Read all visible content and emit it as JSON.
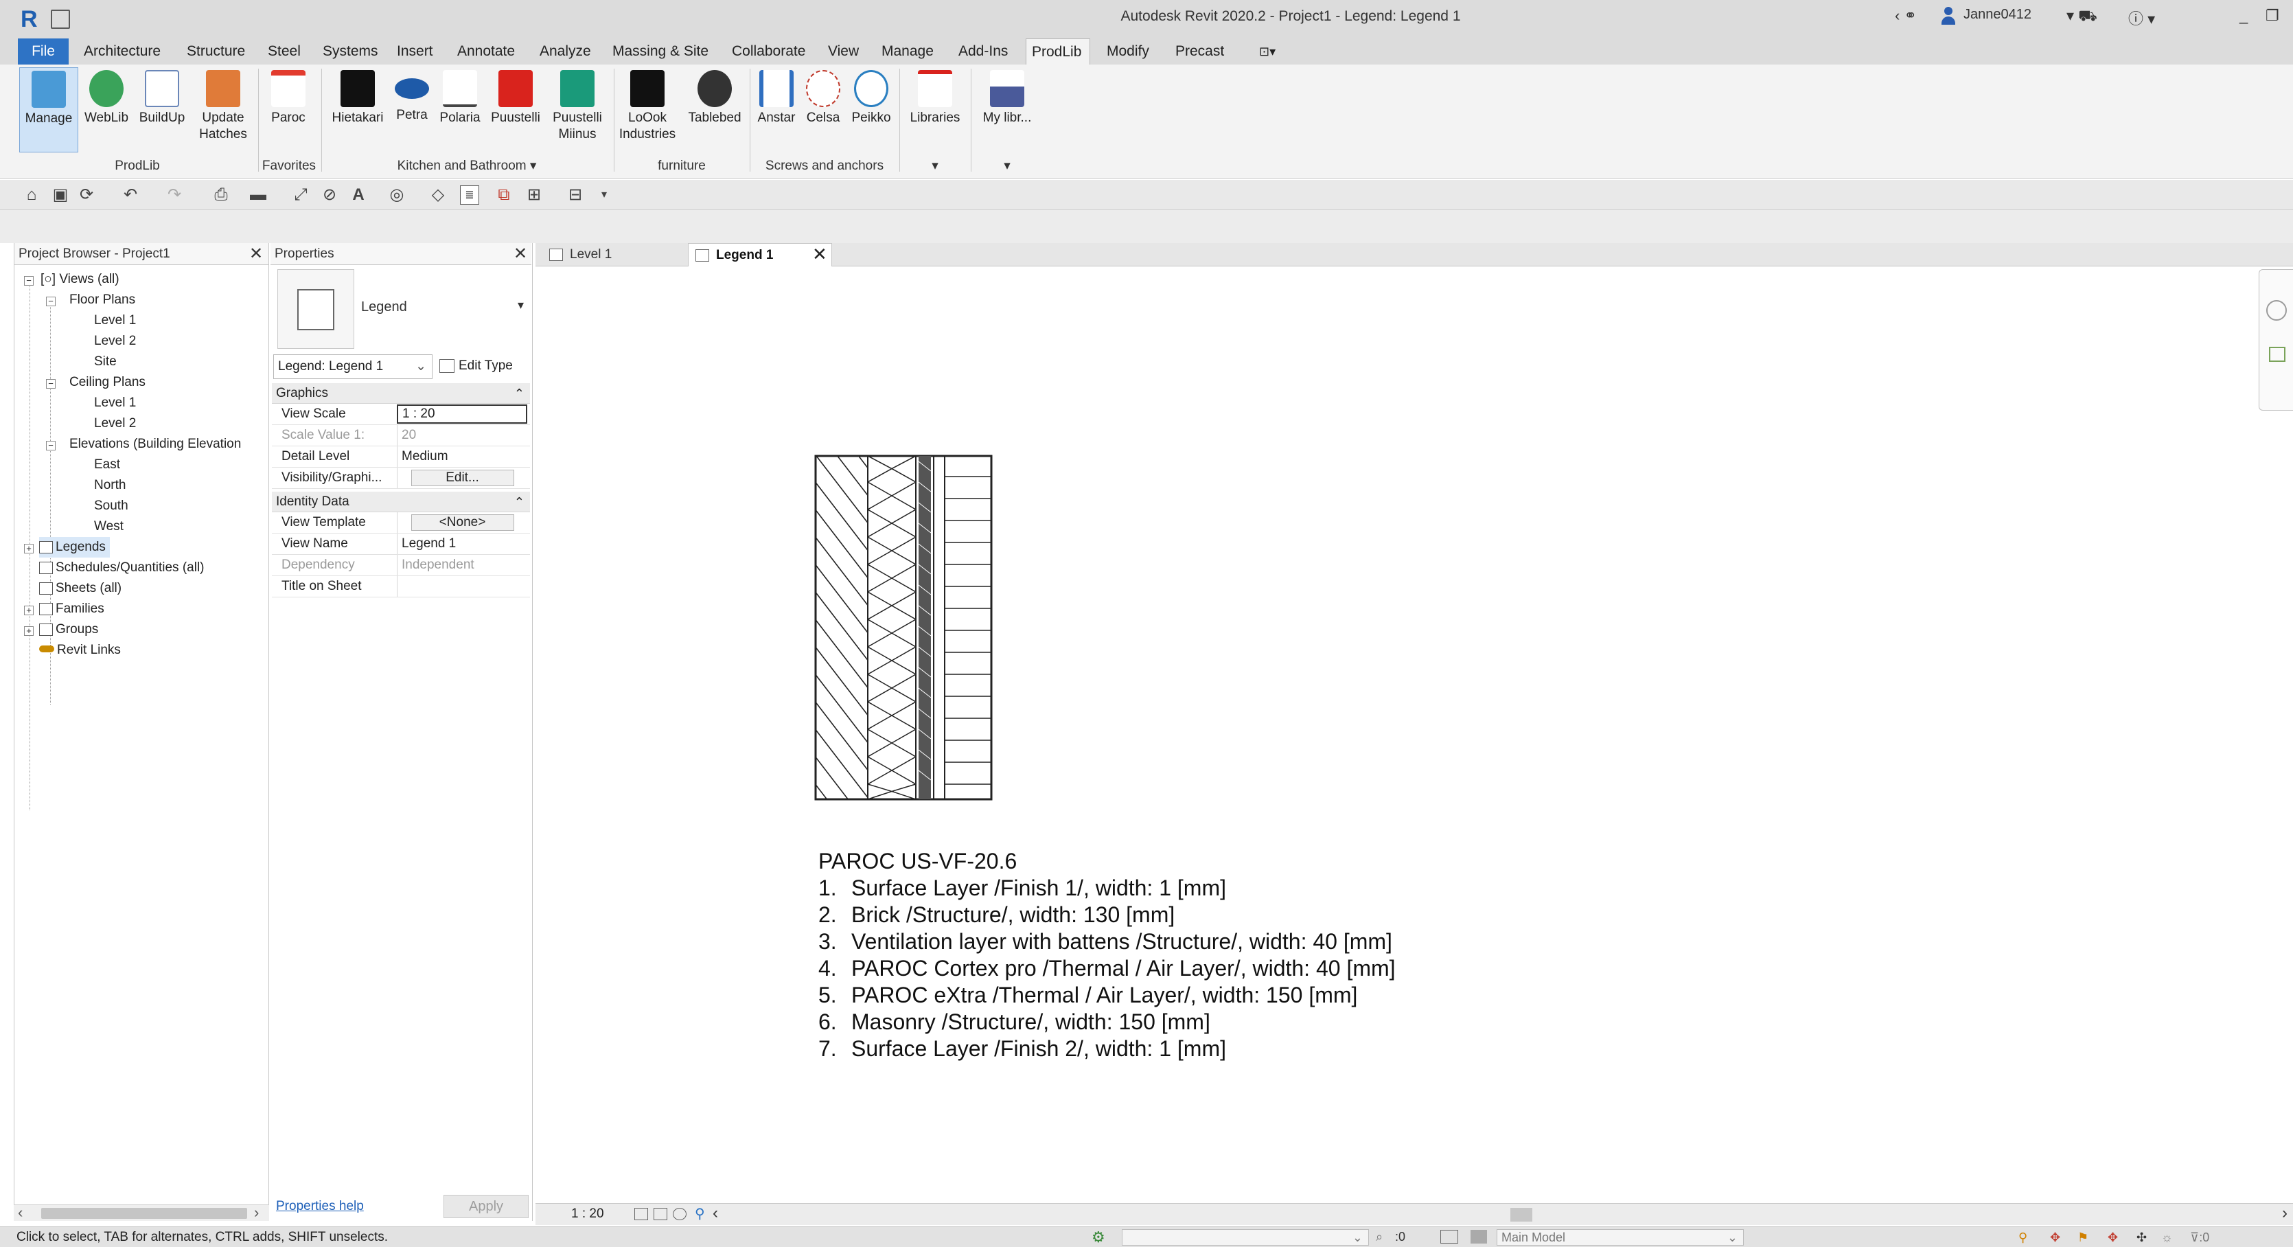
{
  "app": {
    "logo": "R",
    "title": "Autodesk Revit 2020.2 - Project1 - Legend: Legend 1",
    "user": "Janne0412"
  },
  "ribbon_tabs": [
    "File",
    "Architecture",
    "Structure",
    "Steel",
    "Systems",
    "Insert",
    "Annotate",
    "Analyze",
    "Massing & Site",
    "Collaborate",
    "View",
    "Manage",
    "Add-Ins",
    "ProdLib",
    "Modify",
    "Precast"
  ],
  "ribbon": {
    "buttons": [
      {
        "label": "Manage",
        "color": "#4a9ad6"
      },
      {
        "label": "WebLib",
        "color": "#3aa35a"
      },
      {
        "label": "BuildUp",
        "color": "#6a86b8"
      },
      {
        "label": "Update\nHatches",
        "color": "#e07b39"
      },
      {
        "label": "Paroc",
        "color": "#e23b2e"
      },
      {
        "label": "Hietakari",
        "color": "#111111"
      },
      {
        "label": "Petra",
        "color": "#1e5aa8"
      },
      {
        "label": "Polaria",
        "color": "#444444"
      },
      {
        "label": "Puustelli",
        "color": "#d9231d"
      },
      {
        "label": "Puustelli\nMiinus",
        "color": "#1a9a7a"
      },
      {
        "label": "LoOok\nIndustries",
        "color": "#111111"
      },
      {
        "label": "Tablebed",
        "color": "#333333"
      },
      {
        "label": "Anstar",
        "color": "#2f6fc0"
      },
      {
        "label": "Celsa",
        "color": "#c0392b"
      },
      {
        "label": "Peikko",
        "color": "#2a7fc1"
      },
      {
        "label": "Libraries",
        "color": "#d9231d"
      },
      {
        "label": "My libr...",
        "color": "#4a5a9a"
      }
    ],
    "panels": [
      "ProdLib",
      "Favorites",
      "Kitchen and Bathroom",
      "furniture",
      "Screws and anchors"
    ]
  },
  "project_browser": {
    "title": "Project Browser - Project1",
    "items": [
      {
        "label": "Views (all)"
      },
      {
        "label": "Floor Plans"
      },
      {
        "label": "Level 1"
      },
      {
        "label": "Level 2"
      },
      {
        "label": "Site"
      },
      {
        "label": "Ceiling Plans"
      },
      {
        "label": "Level 1"
      },
      {
        "label": "Level 2"
      },
      {
        "label": "Elevations (Building Elevation"
      },
      {
        "label": "East"
      },
      {
        "label": "North"
      },
      {
        "label": "South"
      },
      {
        "label": "West"
      },
      {
        "label": "Legends"
      },
      {
        "label": "Schedules/Quantities (all)"
      },
      {
        "label": "Sheets (all)"
      },
      {
        "label": "Families"
      },
      {
        "label": "Groups"
      },
      {
        "label": "Revit Links"
      }
    ]
  },
  "properties": {
    "title": "Properties",
    "type_name": "Legend",
    "selector": "Legend: Legend 1",
    "edit_type": "Edit Type",
    "groups": {
      "graphics": "Graphics",
      "identity": "Identity Data"
    },
    "rows": {
      "view_scale": {
        "key": "View Scale",
        "value": "1 : 20"
      },
      "scale_value": {
        "key": "Scale Value    1:",
        "value": "20"
      },
      "detail_level": {
        "key": "Detail Level",
        "value": "Medium"
      },
      "visibility": {
        "key": "Visibility/Graphi...",
        "value": "Edit..."
      },
      "view_template": {
        "key": "View Template",
        "value": "<None>"
      },
      "view_name": {
        "key": "View Name",
        "value": "Legend 1"
      },
      "dependency": {
        "key": "Dependency",
        "value": "Independent"
      },
      "title_on_sheet": {
        "key": "Title on Sheet",
        "value": ""
      }
    },
    "help_link": "Properties help",
    "apply": "Apply"
  },
  "view_tabs": [
    {
      "label": "Level 1"
    },
    {
      "label": "Legend 1"
    }
  ],
  "legend": {
    "title": "PAROC US-VF-20.6",
    "items": [
      {
        "num": "1.",
        "text": "Surface Layer /Finish 1/, width: 1 [mm]"
      },
      {
        "num": "2.",
        "text": "Brick /Structure/, width: 130 [mm]"
      },
      {
        "num": "3.",
        "text": "Ventilation layer with battens /Structure/, width: 40 [mm]"
      },
      {
        "num": "4.",
        "text": "PAROC Cortex pro /Thermal / Air Layer/, width: 40 [mm]"
      },
      {
        "num": "5.",
        "text": "PAROC eXtra /Thermal / Air Layer/, width: 150 [mm]"
      },
      {
        "num": "6.",
        "text": "Masonry /Structure/, width: 150 [mm]"
      },
      {
        "num": "7.",
        "text": "Surface Layer /Finish 2/, width: 1 [mm]"
      }
    ]
  },
  "view_control": {
    "scale": "1 : 20"
  },
  "status": {
    "message": "Click to select, TAB for alternates, CTRL adds, SHIFT unselects.",
    "zero": ":0",
    "model": "Main Model",
    "filter_count": ":0"
  }
}
